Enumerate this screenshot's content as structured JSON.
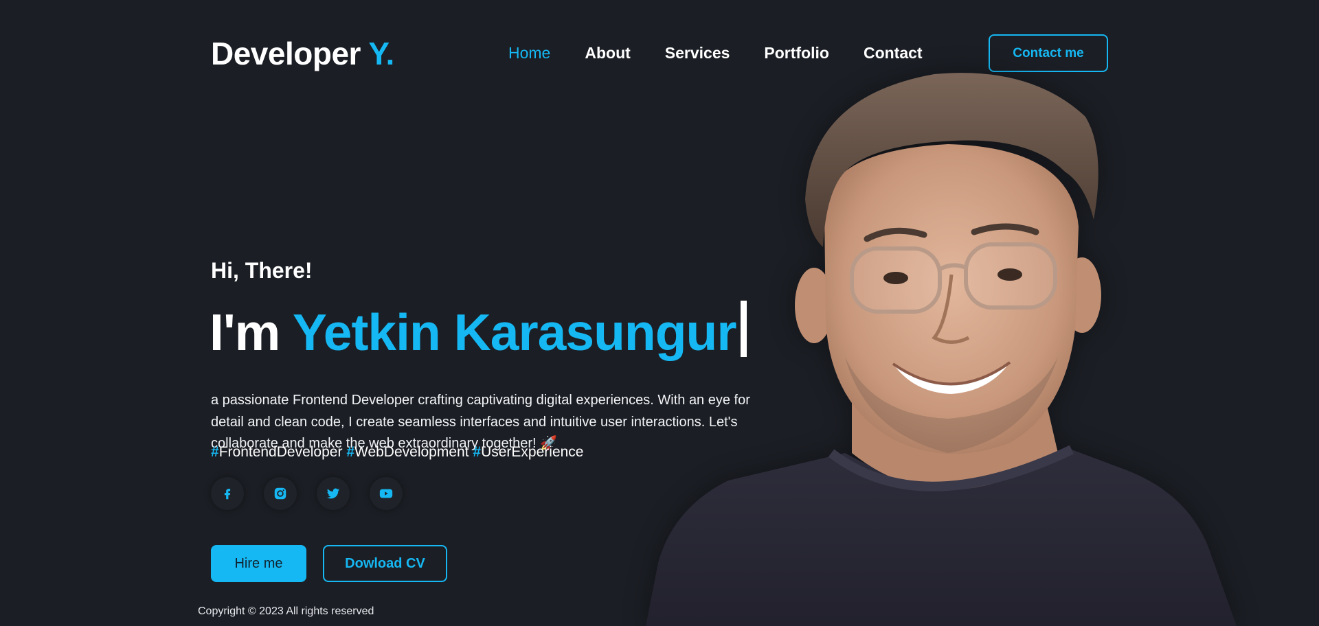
{
  "brand": {
    "logo_text": "Developer",
    "logo_accent": "Y."
  },
  "nav": {
    "items": [
      {
        "label": "Home",
        "active": true
      },
      {
        "label": "About"
      },
      {
        "label": "Services"
      },
      {
        "label": "Portfolio"
      },
      {
        "label": "Contact"
      }
    ],
    "cta_label": "Contact me"
  },
  "hero": {
    "greeting": "Hi, There!",
    "intro": "I'm",
    "name": "Yetkin Karasungur",
    "description": "a passionate Frontend Developer crafting captivating digital experiences. With an eye for detail and clean code, I create seamless interfaces and intuitive user interactions. Let's collaborate and make the web extraordinary together! 🚀",
    "hashtags": [
      {
        "hash": "#",
        "tag": "FrontendDeveloper"
      },
      {
        "hash": "#",
        "tag": "WebDevelopment"
      },
      {
        "hash": "#",
        "tag": "UserExperience"
      }
    ],
    "socials": [
      "facebook-icon",
      "instagram-icon",
      "twitter-icon",
      "youtube-icon"
    ],
    "hire_label": "Hire me",
    "cv_label": "Dowload CV"
  },
  "footer": {
    "copyright": "Copyright © 2023 All rights reserved"
  },
  "colors": {
    "background": "#1b1e24",
    "accent": "#16b8f3",
    "text": "#ffffff"
  }
}
